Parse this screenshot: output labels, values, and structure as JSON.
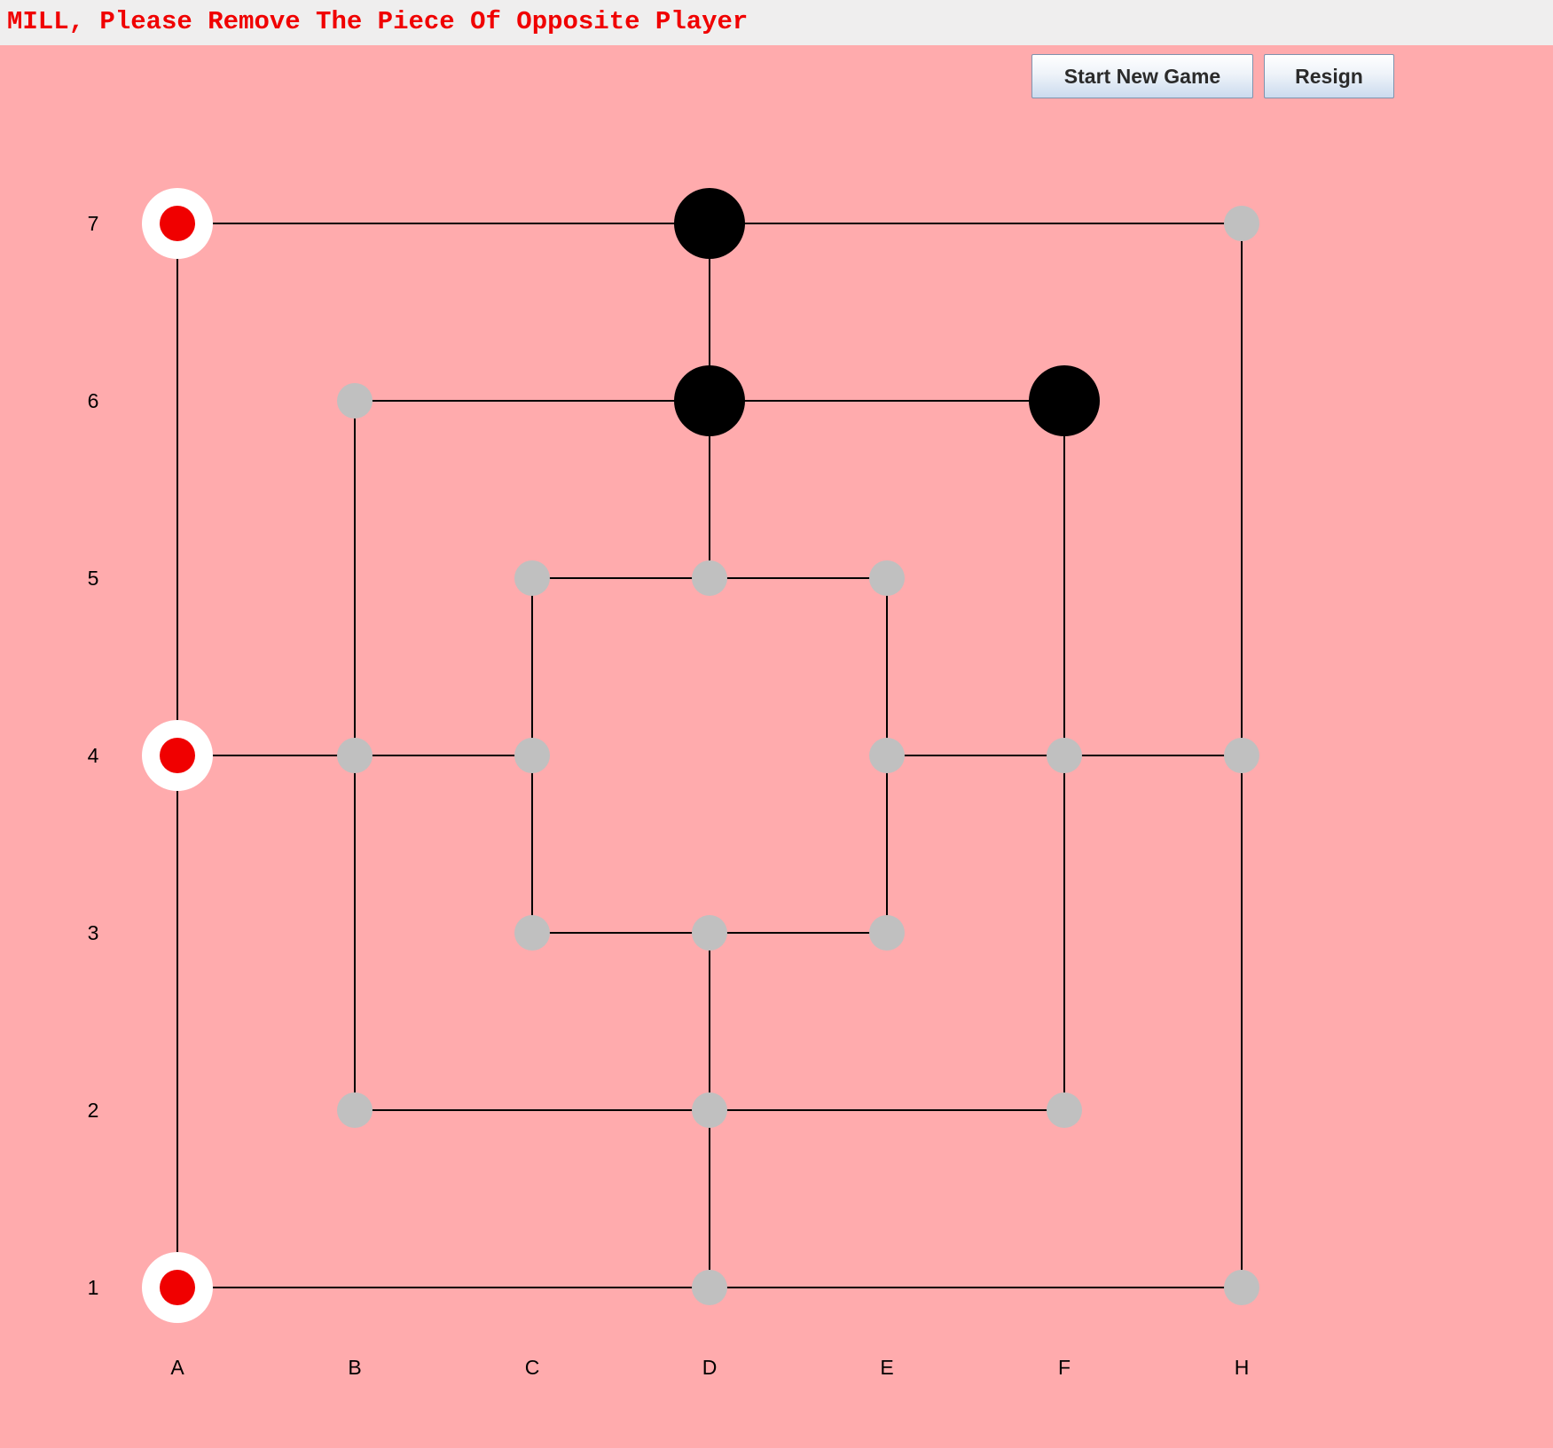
{
  "status": {
    "message": "MILL, Please Remove The Piece Of Opposite Player"
  },
  "toolbar": {
    "new_game_label": "Start New Game",
    "resign_label": "Resign"
  },
  "board": {
    "columns": [
      "A",
      "B",
      "C",
      "D",
      "E",
      "F",
      "H"
    ],
    "rows": [
      "7",
      "6",
      "5",
      "4",
      "3",
      "2",
      "1"
    ],
    "colors": {
      "background": "#ffabad",
      "line": "#000000",
      "empty_point": "#c0c0c0",
      "red_piece": "#f00000",
      "red_ring": "#ffffff",
      "black_piece": "#000000"
    },
    "points": [
      {
        "id": "A7",
        "state": "red"
      },
      {
        "id": "D7",
        "state": "black"
      },
      {
        "id": "H7",
        "state": "empty"
      },
      {
        "id": "B6",
        "state": "empty"
      },
      {
        "id": "D6",
        "state": "black"
      },
      {
        "id": "F6",
        "state": "black"
      },
      {
        "id": "C5",
        "state": "empty"
      },
      {
        "id": "D5",
        "state": "empty"
      },
      {
        "id": "E5",
        "state": "empty"
      },
      {
        "id": "A4",
        "state": "red"
      },
      {
        "id": "B4",
        "state": "empty"
      },
      {
        "id": "C4",
        "state": "empty"
      },
      {
        "id": "E4",
        "state": "empty"
      },
      {
        "id": "F4",
        "state": "empty"
      },
      {
        "id": "H4",
        "state": "empty"
      },
      {
        "id": "C3",
        "state": "empty"
      },
      {
        "id": "D3",
        "state": "empty"
      },
      {
        "id": "E3",
        "state": "empty"
      },
      {
        "id": "B2",
        "state": "empty"
      },
      {
        "id": "D2",
        "state": "empty"
      },
      {
        "id": "F2",
        "state": "empty"
      },
      {
        "id": "A1",
        "state": "red"
      },
      {
        "id": "D1",
        "state": "empty"
      },
      {
        "id": "H1",
        "state": "empty"
      }
    ],
    "lines": [
      [
        "A7",
        "H7"
      ],
      [
        "B6",
        "F6"
      ],
      [
        "C5",
        "E5"
      ],
      [
        "C3",
        "E3"
      ],
      [
        "B2",
        "F2"
      ],
      [
        "A1",
        "H1"
      ],
      [
        "A4",
        "C4"
      ],
      [
        "E4",
        "H4"
      ],
      [
        "A7",
        "A1"
      ],
      [
        "B6",
        "B2"
      ],
      [
        "C5",
        "C3"
      ],
      [
        "E5",
        "E3"
      ],
      [
        "F6",
        "F2"
      ],
      [
        "H7",
        "H1"
      ],
      [
        "D7",
        "D5"
      ],
      [
        "D3",
        "D1"
      ]
    ]
  }
}
